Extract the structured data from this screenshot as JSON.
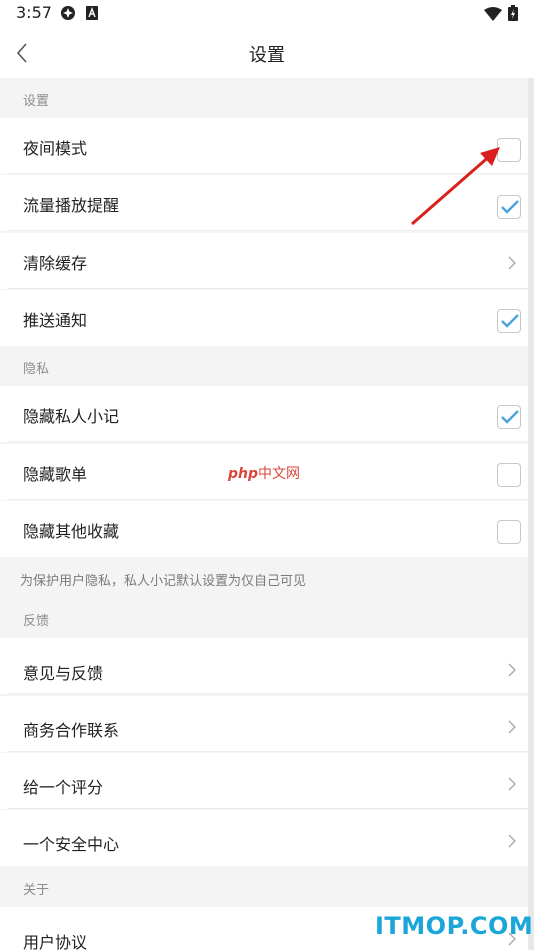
{
  "status_bar": {
    "time": "3:57"
  },
  "nav": {
    "title": "设置"
  },
  "sections": {
    "settings_header": "设置",
    "night_mode": "夜间模式",
    "data_playback_alert": "流量播放提醒",
    "clear_cache": "清除缓存",
    "push_notifications": "推送通知",
    "privacy_header": "隐私",
    "hide_private_notes": "隐藏私人小记",
    "hide_playlists": "隐藏歌单",
    "hide_other_favorites": "隐藏其他收藏",
    "privacy_note": "为保护用户隐私，私人小记默认设置为仅自己可见",
    "feedback_header": "反馈",
    "opinion_feedback": "意见与反馈",
    "business_contact": "商务合作联系",
    "give_rating": "给一个评分",
    "security_center": "一个安全中心",
    "about_header": "关于",
    "user_agreement": "用户协议"
  },
  "checkbox_states": {
    "night_mode": false,
    "data_playback_alert": true,
    "push_notifications": true,
    "hide_private_notes": true,
    "hide_playlists": false,
    "hide_other_favorites": false
  },
  "colors": {
    "check": "#4aa3df",
    "annotation_arrow": "#d9201c"
  },
  "watermarks": {
    "center_php": "php",
    "center_cn": "中文网",
    "corner": "ITMOP.COM"
  }
}
